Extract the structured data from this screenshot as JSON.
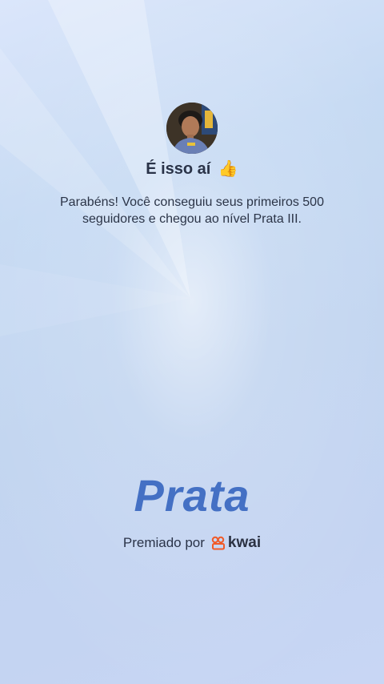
{
  "header": {
    "title": "É isso aí",
    "title_emoji": "👍",
    "avatar_icon": "user-avatar"
  },
  "message": {
    "text": "Parabéns! Você conseguiu seus primeiros 500 seguidores e chegou ao nível Prata III."
  },
  "level": {
    "name": "Prata"
  },
  "footer": {
    "awarded_label": "Premiado por",
    "brand_name": "kwai",
    "brand_icon": "kwai-logo-icon"
  },
  "colors": {
    "level_text": "#4470c4",
    "brand_logo": "#f05a28",
    "text_dark": "#2a3348"
  }
}
